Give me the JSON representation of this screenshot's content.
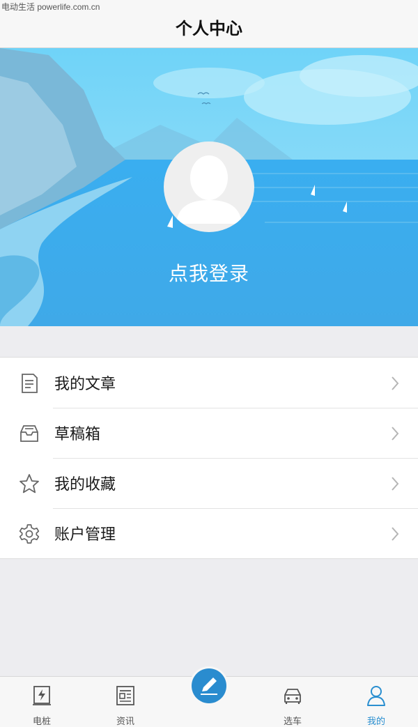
{
  "watermark": "电动生活 powerlife.com.cn",
  "header": {
    "title": "个人中心"
  },
  "profile": {
    "login_label": "点我登录"
  },
  "menu": {
    "items": [
      {
        "label": "我的文章",
        "icon": "article-icon"
      },
      {
        "label": "草稿箱",
        "icon": "drafts-tray-icon"
      },
      {
        "label": "我的收藏",
        "icon": "star-icon"
      },
      {
        "label": "账户管理",
        "icon": "gear-icon"
      }
    ]
  },
  "tabbar": {
    "tabs": [
      {
        "label": "电桩",
        "icon": "charging-pile-icon"
      },
      {
        "label": "资讯",
        "icon": "news-icon"
      },
      {
        "label": "",
        "icon": "pencil-publish-icon"
      },
      {
        "label": "选车",
        "icon": "car-icon"
      },
      {
        "label": "我的",
        "icon": "user-icon",
        "active": true
      }
    ]
  },
  "colors": {
    "accent": "#2a8fd0",
    "banner_sky": "#5ac8f5",
    "banner_sea": "#2fa6e6"
  }
}
